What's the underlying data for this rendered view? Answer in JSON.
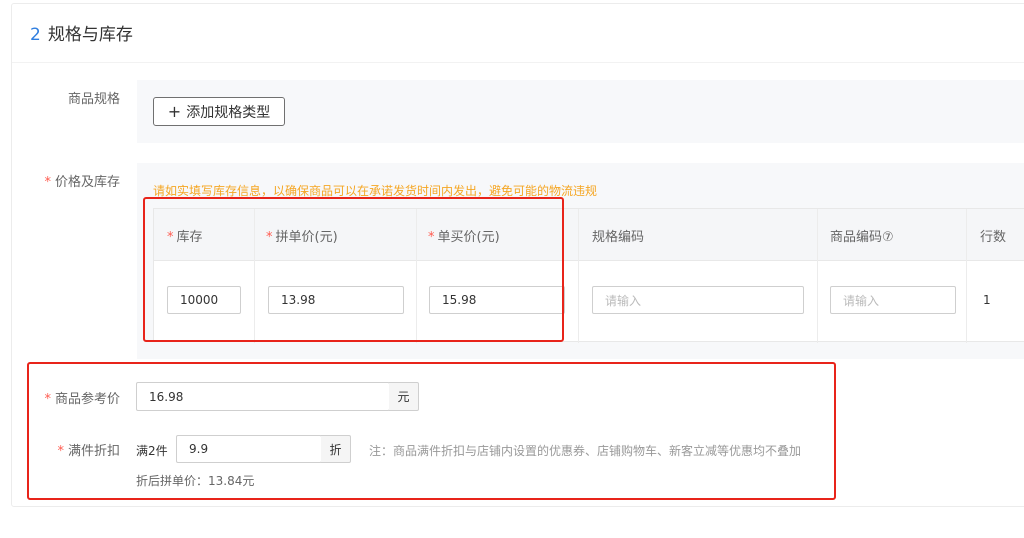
{
  "section": {
    "number": "2",
    "title": "规格与库存"
  },
  "spec": {
    "label": "商品规格",
    "add_button": "添加规格类型"
  },
  "price_stock": {
    "label": "价格及库存",
    "warning": "请如实填写库存信息，以确保商品可以在承诺发货时间内发出，避免可能的物流违规",
    "columns": [
      "库存",
      "拼单价(元)",
      "单买价(元)",
      "规格编码",
      "商品编码⑦",
      "行数"
    ],
    "row": {
      "stock": "10000",
      "group_price": "13.98",
      "single_price": "15.98",
      "spec_code_placeholder": "请输入",
      "product_code_placeholder": "请输入",
      "row_count": "1"
    }
  },
  "ref_price": {
    "label": "商品参考价",
    "value": "16.98",
    "unit": "元"
  },
  "discount": {
    "label": "满件折扣",
    "prefix": "满2件",
    "value": "9.9",
    "unit": "折",
    "note": "注：商品满件折扣与店铺内设置的优惠券、店铺购物车、新客立减等优惠均不叠加",
    "result": "折后拼单价：13.84元"
  },
  "colors": {
    "accent": "#2f7ee0",
    "required": "#ff5b4f",
    "warning": "#f5a623",
    "highlight": "#e8241a"
  }
}
